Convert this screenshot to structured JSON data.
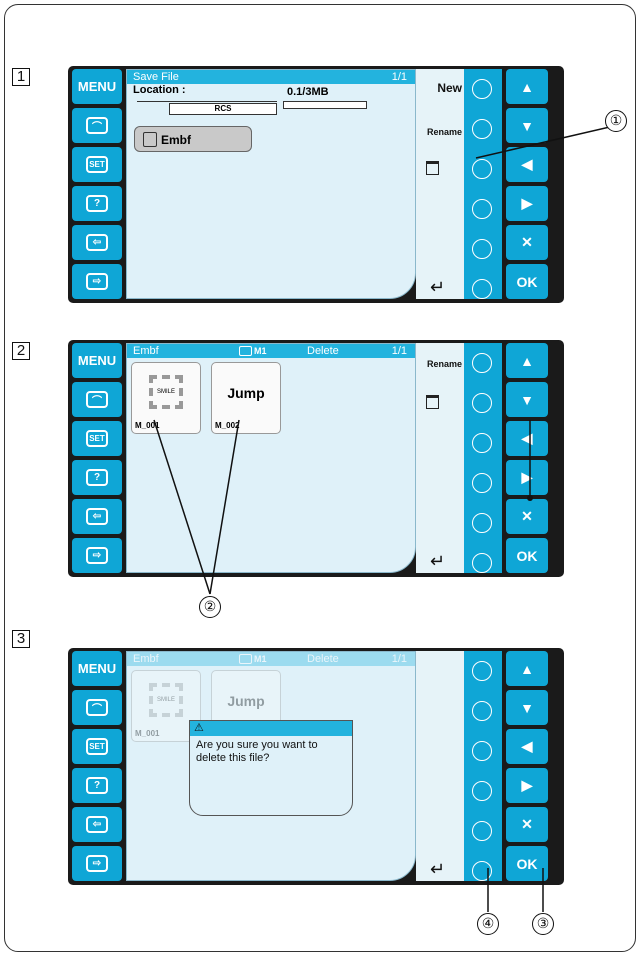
{
  "steps": [
    "1",
    "2",
    "3"
  ],
  "callouts": [
    "①",
    "②",
    "③",
    "④"
  ],
  "left_buttons": {
    "menu": "MENU",
    "set": "SET",
    "help": "?"
  },
  "right_buttons": {
    "up": "▲",
    "down": "▼",
    "left": "◀",
    "right": "▶",
    "cancel": "✕",
    "ok": "OK"
  },
  "screen1": {
    "title": "Save File",
    "page": "1/1",
    "location_label": "Location :",
    "location_value": "RCS",
    "capacity": "0.1/3MB",
    "folder": "Embf",
    "side_labels": {
      "new": "New",
      "rename": "Rename"
    }
  },
  "screen2": {
    "title": "Embf",
    "memory": "M1",
    "mode": "Delete",
    "page": "1/1",
    "files": [
      {
        "name": "M_001",
        "thumb_text": "SMILE"
      },
      {
        "name": "M_002",
        "thumb_text": "Jump"
      }
    ],
    "side_labels": {
      "rename": "Rename"
    }
  },
  "screen3": {
    "title": "Embf",
    "memory": "M1",
    "mode": "Delete",
    "page": "1/1",
    "files": [
      {
        "name": "M_001",
        "thumb_text": "SMILE"
      },
      {
        "name": "",
        "thumb_text": "Jump"
      }
    ],
    "dialog_icon": "⚠",
    "dialog_text": "Are you sure you want to delete this file?"
  },
  "icons": [
    "menu-icon",
    "embroidery-hoop-icon",
    "set-icon",
    "help-icon",
    "transfer-icon",
    "receive-icon",
    "trash-icon",
    "return-arrow-icon",
    "folder-icon",
    "warning-icon"
  ]
}
